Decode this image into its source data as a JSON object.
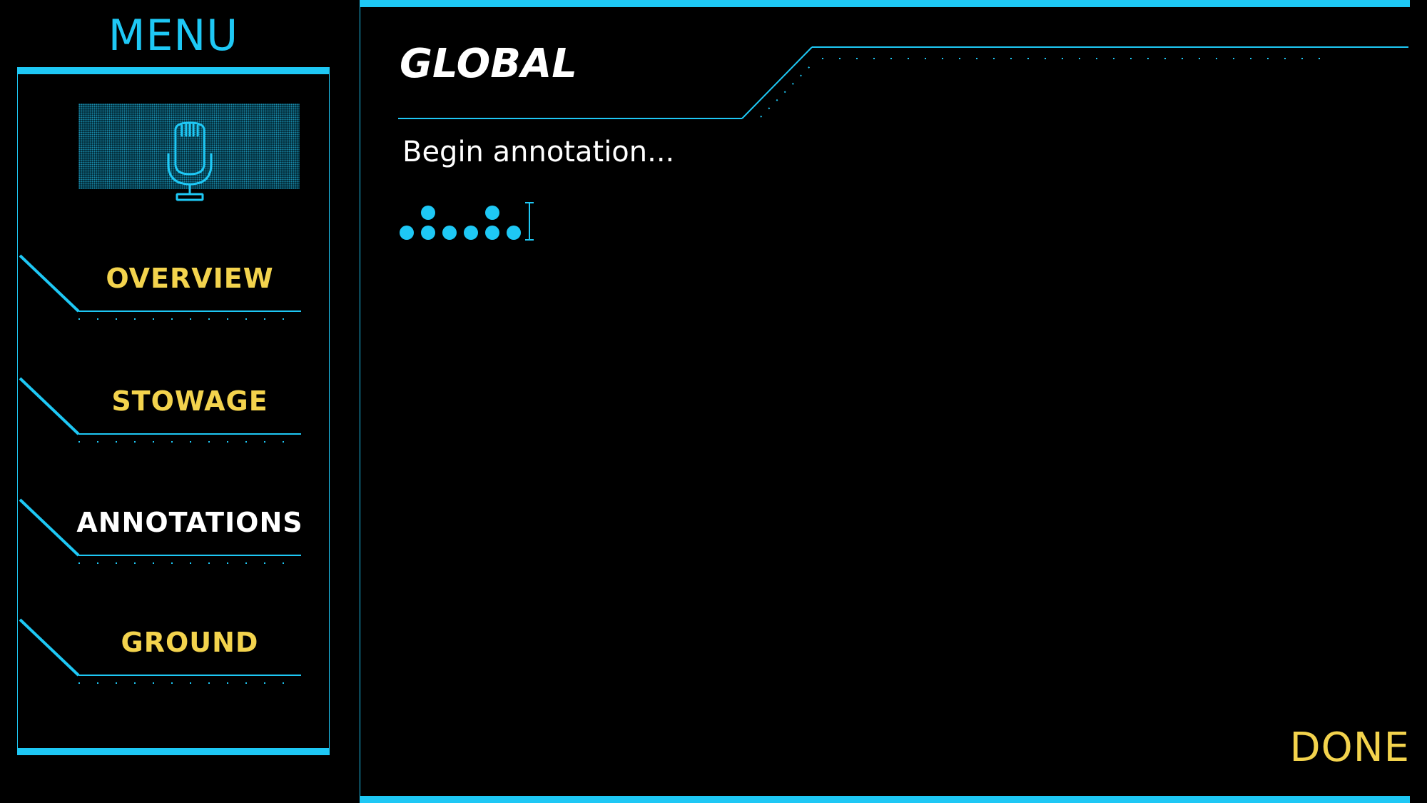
{
  "menu": {
    "title": "MENU",
    "mic_icon": "microphone-icon",
    "items": [
      {
        "id": "overview",
        "label": "OVERVIEW",
        "active": false
      },
      {
        "id": "stowage",
        "label": "STOWAGE",
        "active": false
      },
      {
        "id": "annotations",
        "label": "ANNOTATIONS",
        "active": true
      },
      {
        "id": "ground",
        "label": "GROUND",
        "active": false
      }
    ]
  },
  "main": {
    "title": "GLOBAL",
    "prompt": "Begin annotation...",
    "done_label": "DONE"
  },
  "colors": {
    "accent": "#1ec8f5",
    "label_yellow": "#f3d34d",
    "active_label": "#ffffff",
    "background": "#000000"
  }
}
